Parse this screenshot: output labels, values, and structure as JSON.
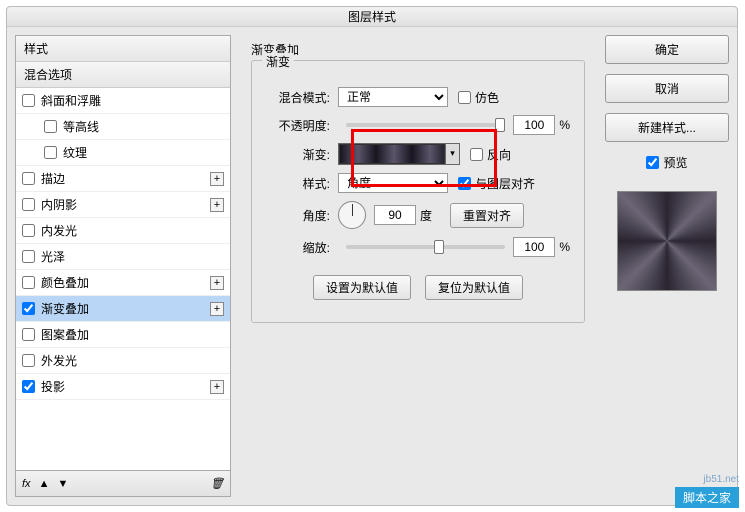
{
  "dialog": {
    "title": "图层样式"
  },
  "left": {
    "header": "样式",
    "blend_header": "混合选项",
    "items": [
      {
        "label": "斜面和浮雕",
        "checked": false,
        "plus": false
      },
      {
        "label": "等高线",
        "checked": false,
        "plus": false,
        "sub": true
      },
      {
        "label": "纹理",
        "checked": false,
        "plus": false,
        "sub": true
      },
      {
        "label": "描边",
        "checked": false,
        "plus": true
      },
      {
        "label": "内阴影",
        "checked": false,
        "plus": true
      },
      {
        "label": "内发光",
        "checked": false,
        "plus": false
      },
      {
        "label": "光泽",
        "checked": false,
        "plus": false
      },
      {
        "label": "颜色叠加",
        "checked": false,
        "plus": true
      },
      {
        "label": "渐变叠加",
        "checked": true,
        "plus": true,
        "selected": true
      },
      {
        "label": "图案叠加",
        "checked": false,
        "plus": false
      },
      {
        "label": "外发光",
        "checked": false,
        "plus": false
      },
      {
        "label": "投影",
        "checked": true,
        "plus": true
      }
    ],
    "fx_label": "fx"
  },
  "center": {
    "section_title": "渐变叠加",
    "legend": "渐变",
    "blend_mode_label": "混合模式:",
    "blend_mode_value": "正常",
    "dither_label": "仿色",
    "opacity_label": "不透明度:",
    "opacity_value": "100",
    "opacity_unit": "%",
    "gradient_label": "渐变:",
    "reverse_label": "反向",
    "style_label": "样式:",
    "style_value": "角度",
    "align_label": "与图层对齐",
    "align_checked": true,
    "angle_label": "角度:",
    "angle_value": "90",
    "angle_unit": "度",
    "reset_align": "重置对齐",
    "scale_label": "缩放:",
    "scale_value": "100",
    "scale_unit": "%",
    "make_default": "设置为默认值",
    "reset_default": "复位为默认值"
  },
  "right": {
    "ok": "确定",
    "cancel": "取消",
    "new_style": "新建样式...",
    "preview_label": "预览",
    "preview_checked": true
  },
  "watermark": {
    "url": "jb51.net",
    "cn": "脚本之家"
  }
}
